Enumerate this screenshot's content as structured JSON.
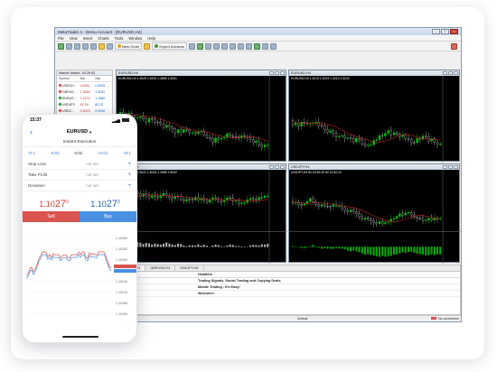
{
  "terminal": {
    "title": "MetaTrader 4 - Demo Account - [EURUSD,H4]",
    "menu": [
      "File",
      "View",
      "Insert",
      "Charts",
      "Tools",
      "Window",
      "Help"
    ],
    "toolbar": {
      "new_order_label": "New Order",
      "expert_label": "Expert Advisors"
    },
    "market_watch": {
      "title": "Market Watch: 16:26:53",
      "columns": [
        "Symbol",
        "Bid",
        "Ask"
      ],
      "rows": [
        {
          "symbol": "USDCH...",
          "bid": "0.8911",
          "ask": "0.8926",
          "color": "#d9534f"
        },
        {
          "symbol": "GBPUS...",
          "bid": "1.3082",
          "ask": "1.3092",
          "color": "#d9534f"
        },
        {
          "symbol": "EURUS...",
          "bid": "1.1674",
          "ask": "1.1680",
          "color": "#3c9a3c"
        },
        {
          "symbol": "USDJPY",
          "bid": "82.18",
          "ask": "82.22",
          "color": "#3c9a3c"
        },
        {
          "symbol": "USDC...",
          "bid": "0.9023",
          "ask": "0.9036",
          "color": "#d9534f"
        },
        {
          "symbol": "AUDUS...",
          "bid": "0.9815",
          "ask": "0.9826",
          "color": "#3c9a3c"
        }
      ]
    },
    "charts": [
      {
        "title": "EURUSD,H4",
        "info": "EURUSD,H4 1.4925 1.4932 1.4898 1.4901"
      },
      {
        "title": "EURUSD,H4",
        "info": "EURUSD,H4 1.3213 1.3224 1.3213 1.3221"
      },
      {
        "title": "GBPUSD,H4",
        "info": "GBPUSD,H4 1.5021 1.5034 1.4998 1.5002"
      },
      {
        "title": "USDJPY,H4",
        "info": "USDJPY,H4 82.18 82.25 82.10 82.22"
      }
    ],
    "chart_tabs": [
      "USDCHF,H4",
      "GBPUSD,H4",
      "USDJPY,H4"
    ],
    "news": {
      "header": "Headline",
      "rows": [
        "Trading Signals, Social Trading and Copying Deals",
        "Mobile Trading - It's Easy!",
        "Welcome!"
      ]
    },
    "bottom_tabs": [
      "Trade",
      "Exposure",
      "Account History",
      "News",
      "Alerts",
      "Mailbox",
      "Experts",
      "Journal"
    ],
    "status": {
      "profile": "Default",
      "connection": "No connection"
    }
  },
  "phone": {
    "time": "15:37",
    "symbol": "EURUSD",
    "mode": "Instant Execution",
    "lots": [
      "-0.1",
      "-0.01",
      "0.01",
      "+0.01",
      "+0.1"
    ],
    "fields": [
      {
        "label": "Stop Loss",
        "value": "not set"
      },
      {
        "label": "Take Profit",
        "value": "not set"
      },
      {
        "label": "Deviation",
        "value": "not set"
      }
    ],
    "bid": {
      "main": "1.10",
      "big": "27",
      "sup": "0"
    },
    "ask": {
      "main": "1.10",
      "big": "27",
      "sup": "3"
    },
    "sell_label": "Sell",
    "buy_label": "Buy",
    "axis": [
      "1.10360",
      "1.10330",
      "1.10300",
      "1.10270",
      "1.10240",
      "1.10210",
      "1.10180",
      "1.10150"
    ]
  },
  "colors": {
    "bull": "#00c800",
    "bear": "#ffffff",
    "ma": "#c02020",
    "sell": "#d9534f",
    "buy": "#4a90e2"
  }
}
